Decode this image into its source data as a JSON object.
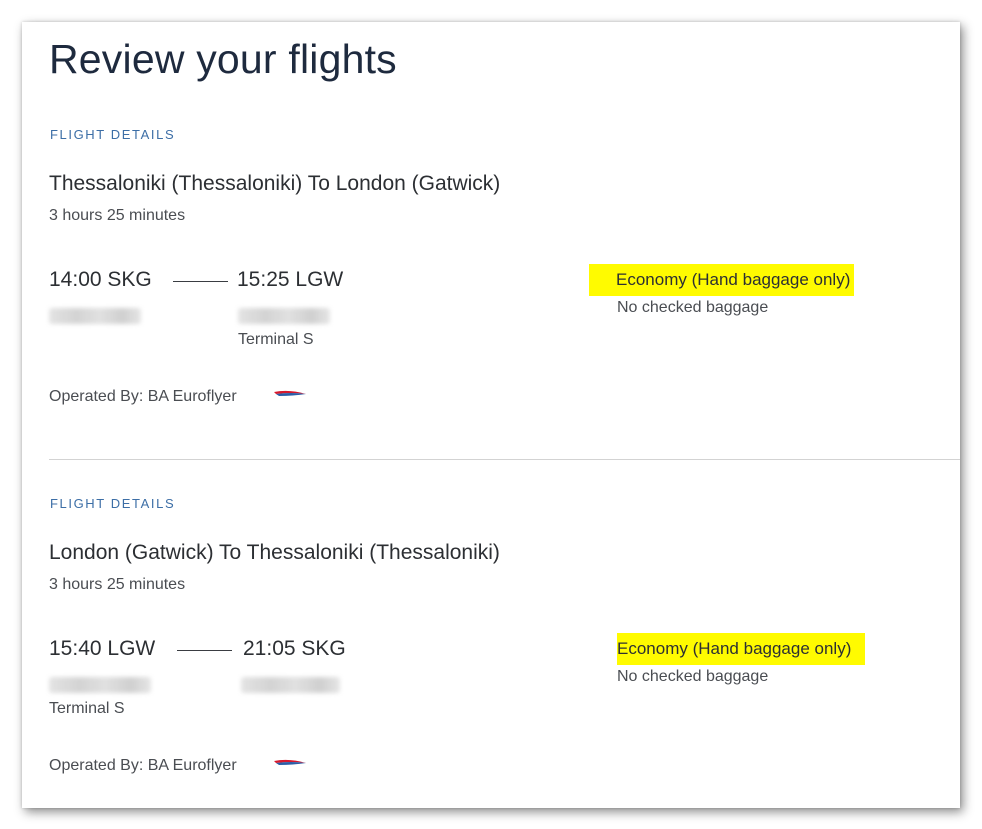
{
  "page": {
    "title": "Review your flights"
  },
  "flights": [
    {
      "section_label": "FLIGHT DETAILS",
      "route": "Thessaloniki (Thessaloniki) To London (Gatwick)",
      "duration": "3 hours 25 minutes",
      "depart_time": "14:00 SKG",
      "arrive_time": "15:25 LGW",
      "depart_terminal": "",
      "arrive_terminal": "Terminal S",
      "cabin": "Economy (Hand baggage only)",
      "baggage": "No checked baggage",
      "operator": "Operated By: BA Euroflyer"
    },
    {
      "section_label": "FLIGHT DETAILS",
      "route": "London (Gatwick) To Thessaloniki (Thessaloniki)",
      "duration": "3 hours 25 minutes",
      "depart_time": "15:40 LGW",
      "arrive_time": "21:05 SKG",
      "depart_terminal": "Terminal S",
      "arrive_terminal": "",
      "cabin": "Economy (Hand baggage only)",
      "baggage": "No checked baggage",
      "operator": "Operated By: BA Euroflyer"
    }
  ],
  "colors": {
    "title": "#1e2a3e",
    "section_label": "#3c6ea6",
    "highlight": "#fffb00",
    "ba_logo_red": "#d7192d",
    "ba_logo_blue": "#2b5ea7"
  },
  "icons": {
    "operator_logo": "ba-speedmarque-icon"
  }
}
